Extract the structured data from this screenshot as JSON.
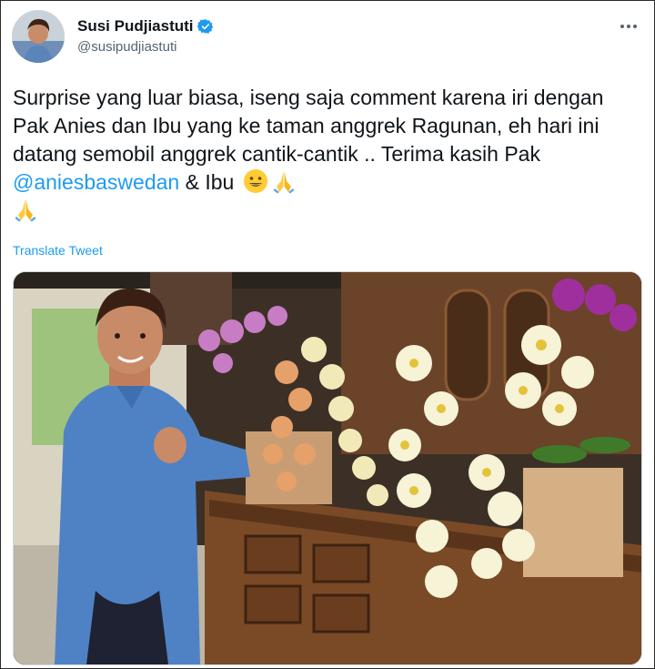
{
  "tweet": {
    "display_name": "Susi Pudjiastuti",
    "handle": "@susipudjiastuti",
    "verified": true,
    "more_icon": "more-horizontal-icon",
    "text_segments": [
      "Surprise yang luar biasa, iseng saja comment karena iri dengan Pak Anies dan Ibu yang ke taman anggrek Ragunan, eh hari ini datang semobil anggrek cantik-cantik .. Terima kasih Pak ",
      " & Ibu "
    ],
    "mention": "@aniesbaswedan",
    "emojis": [
      "grinning-face-emoji",
      "folded-hands-emoji",
      "folded-hands-emoji"
    ],
    "translate_label": "Translate Tweet",
    "media": {
      "type": "photo",
      "subject": "woman in blue shirt beside wooden cabinet with orchid arrangements"
    },
    "colors": {
      "link": "#1d9bf0",
      "text": "#0f1419",
      "secondary": "#536471",
      "verified": "#1d9bf0"
    }
  }
}
